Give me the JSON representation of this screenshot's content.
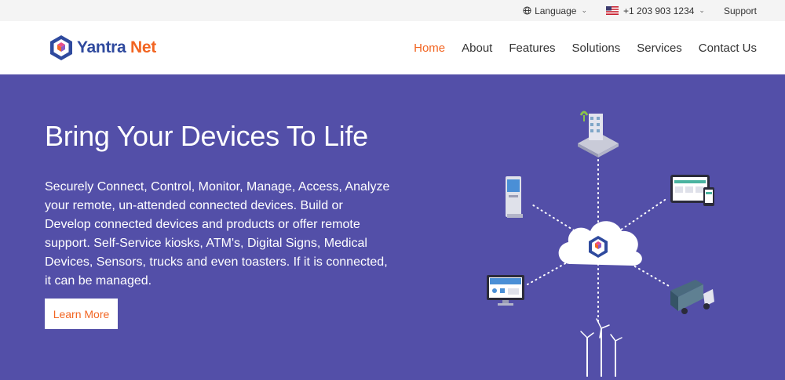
{
  "topbar": {
    "language_label": "Language",
    "phone_label": "+1 203 903 1234",
    "support_label": "Support"
  },
  "brand": {
    "name_part1": "Yantra",
    "name_part2": "Net",
    "primary_color": "#2f4a9e",
    "accent_color": "#f26522"
  },
  "nav": {
    "items": [
      {
        "label": "Home",
        "active": true
      },
      {
        "label": "About",
        "active": false
      },
      {
        "label": "Features",
        "active": false
      },
      {
        "label": "Solutions",
        "active": false
      },
      {
        "label": "Services",
        "active": false
      },
      {
        "label": "Contact Us",
        "active": false
      }
    ]
  },
  "hero": {
    "title": "Bring Your Devices To Life",
    "description": "Securely Connect, Control, Monitor, Manage, Access, Analyze your remote, un-attended connected devices. Build or Develop connected devices and products or offer remote support. Self-Service kiosks, ATM's, Digital Signs, Medical Devices, Sensors, trucks and even toasters. If it is connected, it can be managed.",
    "button_label": "Learn More",
    "background_color": "#534fa8"
  },
  "illustration": {
    "center": "cloud-icon",
    "devices": [
      "smart-building-icon",
      "kiosk-icon",
      "tablet-phone-icon",
      "desktop-monitor-icon",
      "truck-icon",
      "wind-turbine-icon"
    ]
  }
}
